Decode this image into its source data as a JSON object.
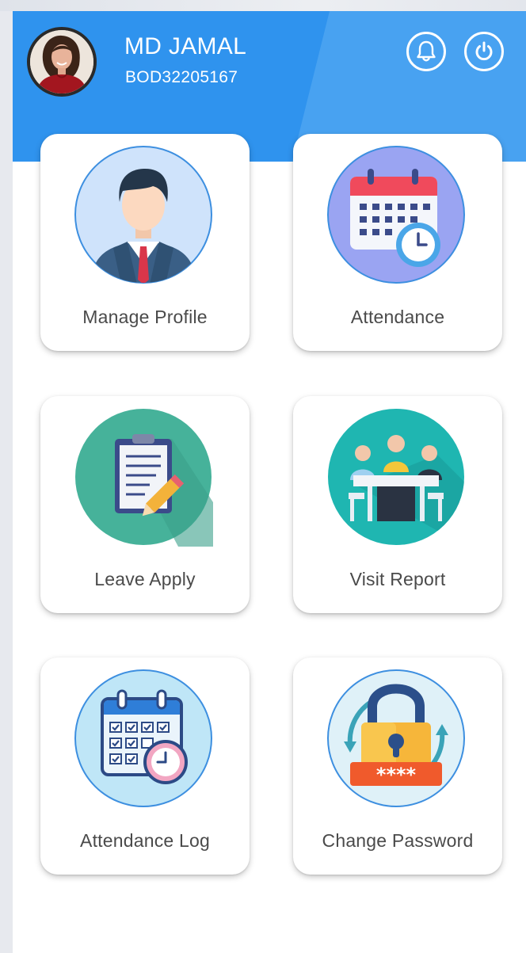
{
  "user": {
    "name": "MD JAMAL",
    "id": "BOD32205167"
  },
  "header": {
    "notification_icon": "bell-icon",
    "logout_icon": "power-icon",
    "accent_color": "#2f93ee"
  },
  "menu": {
    "items": [
      {
        "label": "Manage Profile",
        "icon": "manage-profile-icon"
      },
      {
        "label": "Attendance",
        "icon": "attendance-calendar-icon"
      },
      {
        "label": "Leave Apply",
        "icon": "clipboard-pencil-icon"
      },
      {
        "label": "Visit Report",
        "icon": "meeting-icon"
      },
      {
        "label": "Attendance Log",
        "icon": "calendar-checklist-icon"
      },
      {
        "label": "Change Password",
        "icon": "padlock-icon"
      }
    ]
  }
}
